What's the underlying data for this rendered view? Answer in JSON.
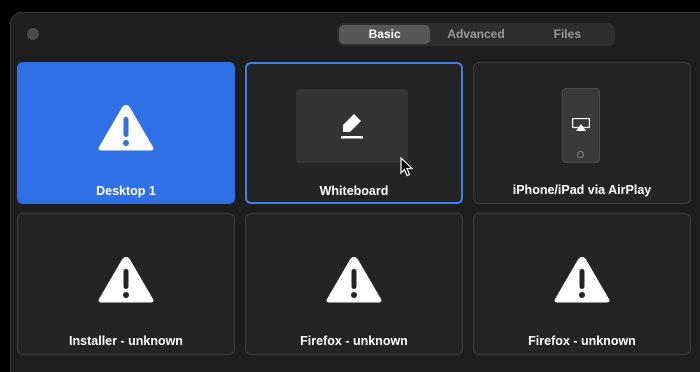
{
  "tabs": [
    {
      "label": "Basic",
      "active": true
    },
    {
      "label": "Advanced",
      "active": false
    },
    {
      "label": "Files",
      "active": false
    }
  ],
  "tiles": [
    {
      "label": "Desktop 1",
      "icon": "warning-icon",
      "state": "selected"
    },
    {
      "label": "Whiteboard",
      "icon": "pen-icon",
      "state": "focused"
    },
    {
      "label": "iPhone/iPad via AirPlay",
      "icon": "airplay-icon",
      "state": "normal"
    },
    {
      "label": "Installer - unknown",
      "icon": "warning-icon",
      "state": "normal"
    },
    {
      "label": "Firefox - unknown",
      "icon": "warning-icon",
      "state": "normal"
    },
    {
      "label": "Firefox - unknown",
      "icon": "warning-icon",
      "state": "normal"
    }
  ],
  "colors": {
    "accent": "#2f70e6",
    "focus_border": "#3d7fe8",
    "window_bg": "#1e1e1e",
    "tile_bg": "#242424"
  }
}
